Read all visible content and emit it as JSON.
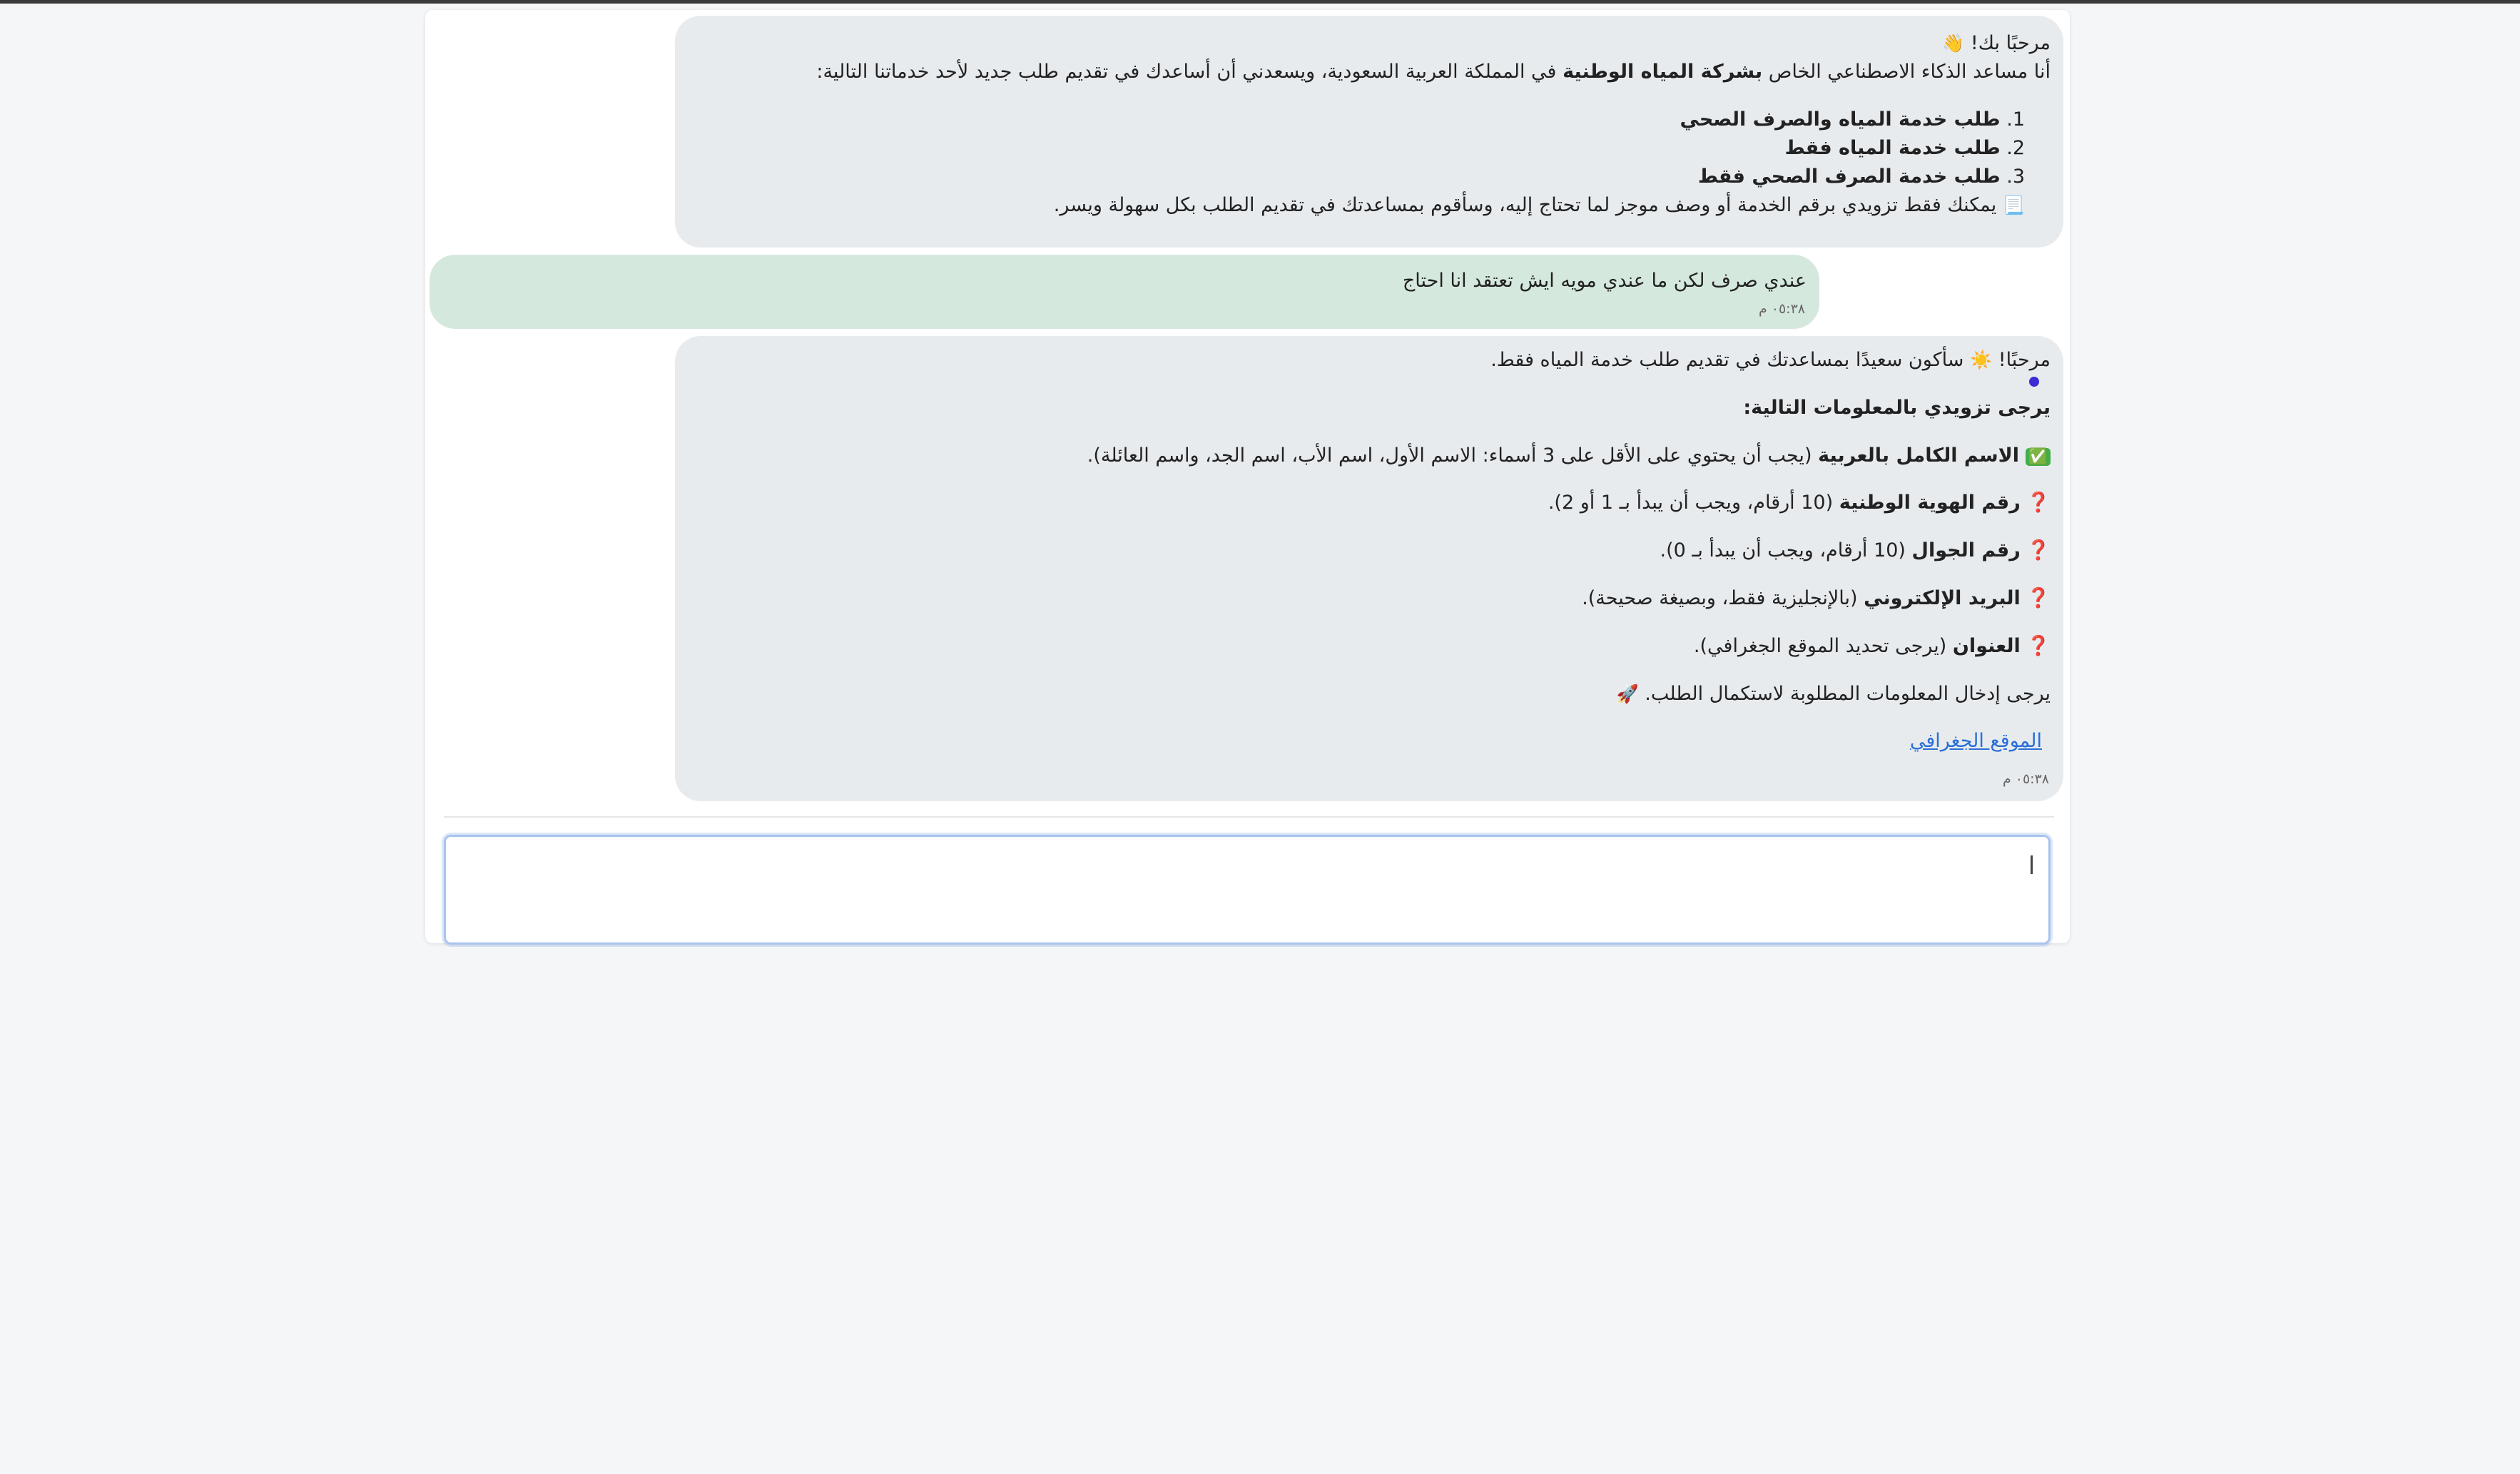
{
  "messages": {
    "welcome": {
      "greeting": "مرحبًا بك!",
      "greeting_emoji": "👋",
      "intro_prefix": "أنا مساعد الذكاء الاصطناعي الخاص",
      "company": "بشركة المياه الوطنية",
      "intro_suffix": "في المملكة العربية السعودية، ويسعدني أن أساعدك في تقديم طلب جديد لأحد خدماتنا التالية:",
      "services": [
        {
          "num": "1.",
          "label": "طلب خدمة المياه والصرف الصحي"
        },
        {
          "num": "2.",
          "label": "طلب خدمة المياه فقط"
        },
        {
          "num": "3.",
          "label": "طلب خدمة الصرف الصحي فقط"
        }
      ],
      "note_emoji": "📃",
      "note": "يمكنك فقط تزويدي برقم الخدمة أو وصف موجز لما تحتاج إليه، وسأقوم بمساعدتك في تقديم الطلب بكل سهولة ويسر."
    },
    "user": {
      "text": "عندي صرف لكن ما عندي مويه ايش تعتقد انا احتاج",
      "time": "٠٥:٣٨ م"
    },
    "reply": {
      "greeting": "مرحبًا!",
      "sun_emoji": "☀️",
      "greeting_rest": "سأكون سعيدًا بمساعدتك في تقديم طلب خدمة المياه فقط.",
      "request_heading": "يرجى تزويدي بالمعلومات التالية:",
      "fields": [
        {
          "emoji": "✅",
          "label": "الاسم الكامل بالعربية",
          "hint": "(يجب أن يحتوي على الأقل على 3 أسماء: الاسم الأول، اسم الأب، اسم الجد، واسم العائلة)."
        },
        {
          "emoji": "❓",
          "label": "رقم الهوية الوطنية",
          "hint": "(10 أرقام، ويجب أن يبدأ بـ 1 أو 2)."
        },
        {
          "emoji": "❓",
          "label": "رقم الجوال",
          "hint": "(10 أرقام، ويجب أن يبدأ بـ 0)."
        },
        {
          "emoji": "❓",
          "label": "البريد الإلكتروني",
          "hint": "(بالإنجليزية فقط، وبصيغة صحيحة)."
        },
        {
          "emoji": "❓",
          "label": "العنوان",
          "hint": "(يرجى تحديد الموقع الجغرافي)."
        }
      ],
      "closing": "يرجى إدخال المعلومات المطلوبة لاستكمال الطلب.",
      "closing_emoji": "🚀",
      "location_link": "الموقع الجغرافي",
      "time": "٠٥:٣٨ م"
    }
  },
  "input": {
    "value": "",
    "placeholder": ""
  },
  "colors": {
    "bot_bubble": "#e8ebee",
    "user_bubble": "#d5e8dd",
    "link": "#2a6fd6",
    "input_focus": "#a9c4ec"
  }
}
